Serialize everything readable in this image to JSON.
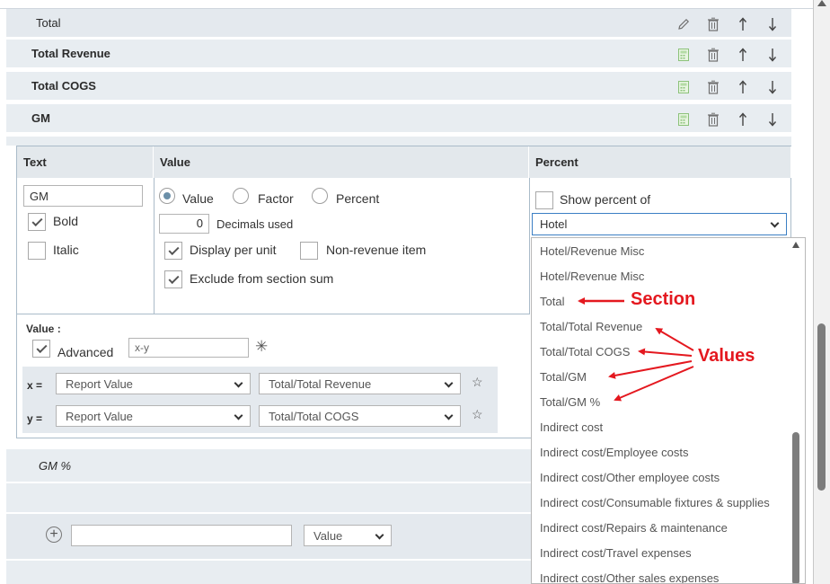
{
  "sections": [
    {
      "name": "Total",
      "bold": false,
      "first_tool": "pencil-icon"
    },
    {
      "name": "Total Revenue",
      "bold": true,
      "first_tool": "calculator-icon"
    },
    {
      "name": "Total COGS",
      "bold": true,
      "first_tool": "calculator-icon"
    },
    {
      "name": "GM",
      "bold": true,
      "first_tool": "calculator-icon"
    }
  ],
  "editor": {
    "headers": {
      "text": "Text",
      "value": "Value",
      "percent": "Percent"
    },
    "text_value": "GM",
    "bold_label": "Bold",
    "italic_label": "Italic",
    "bold_checked": true,
    "italic_checked": false,
    "radio_value": "Value",
    "radio_factor": "Factor",
    "radio_percent": "Percent",
    "decimals": "0",
    "decimals_label": "Decimals used",
    "display_per_unit": "Display per unit",
    "non_revenue": "Non-revenue item",
    "exclude_sum": "Exclude from section sum",
    "show_percent_of": "Show percent of",
    "percent_select": "Hotel",
    "value_section_label": "Value :",
    "advanced_label": "Advanced",
    "formula": "x-y",
    "x_label": "x =",
    "y_label": "y =",
    "x_type": "Report Value",
    "x_target": "Total/Total Revenue",
    "y_type": "Report Value",
    "y_target": "Total/Total COGS"
  },
  "dropdown_items": [
    "Hotel/Revenue Misc",
    "Hotel/Revenue Misc",
    "Total",
    "Total/Total Revenue",
    "Total/Total COGS",
    "Total/GM",
    "Total/GM %",
    "Indirect cost",
    "Indirect cost/Employee costs",
    "Indirect cost/Other employee costs",
    "Indirect cost/Consumable fixtures & supplies",
    "Indirect cost/Repairs & maintenance",
    "Indirect cost/Travel expenses",
    "Indirect cost/Other sales expenses"
  ],
  "annotations": {
    "section": "Section",
    "values": "Values",
    "color": "#e4181f"
  },
  "gm_percent_row": "GM %",
  "add_row": {
    "select_value": "Value"
  }
}
